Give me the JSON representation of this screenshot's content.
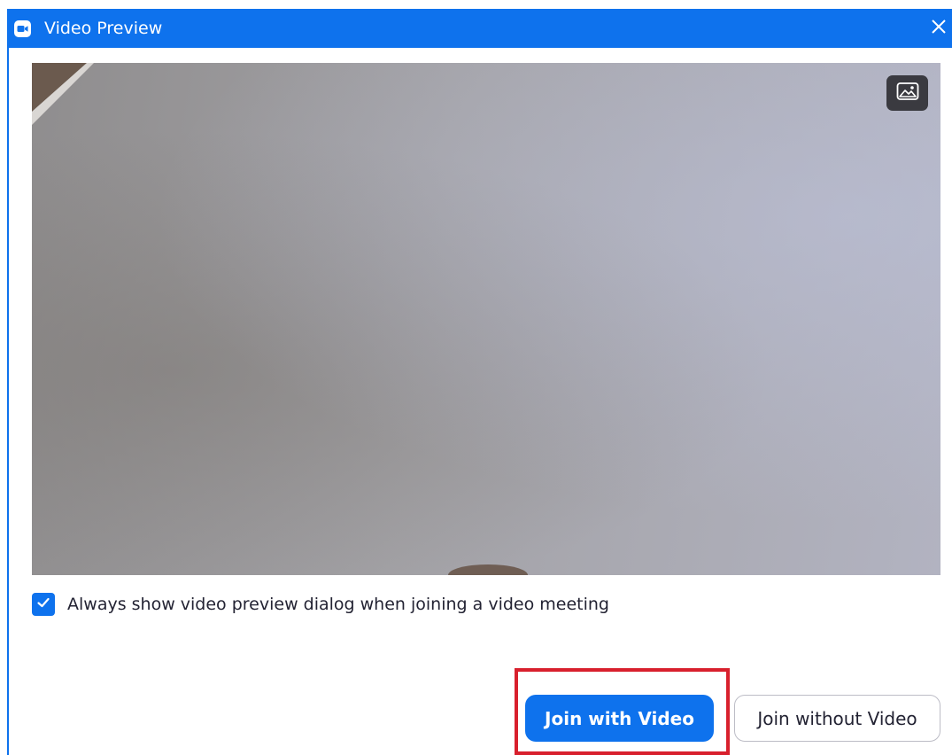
{
  "window": {
    "title": "Video Preview",
    "accent_color": "#0e72ed",
    "highlight_color": "#d8202d"
  },
  "icons": {
    "app": "video-camera-icon",
    "close": "close-icon",
    "background": "virtual-background-icon",
    "check": "checkmark-icon"
  },
  "preview": {
    "always_show_checked": true,
    "always_show_label": "Always show video preview dialog when joining a video meeting"
  },
  "actions": {
    "join_with_video": "Join with Video",
    "join_without_video": "Join without Video"
  }
}
